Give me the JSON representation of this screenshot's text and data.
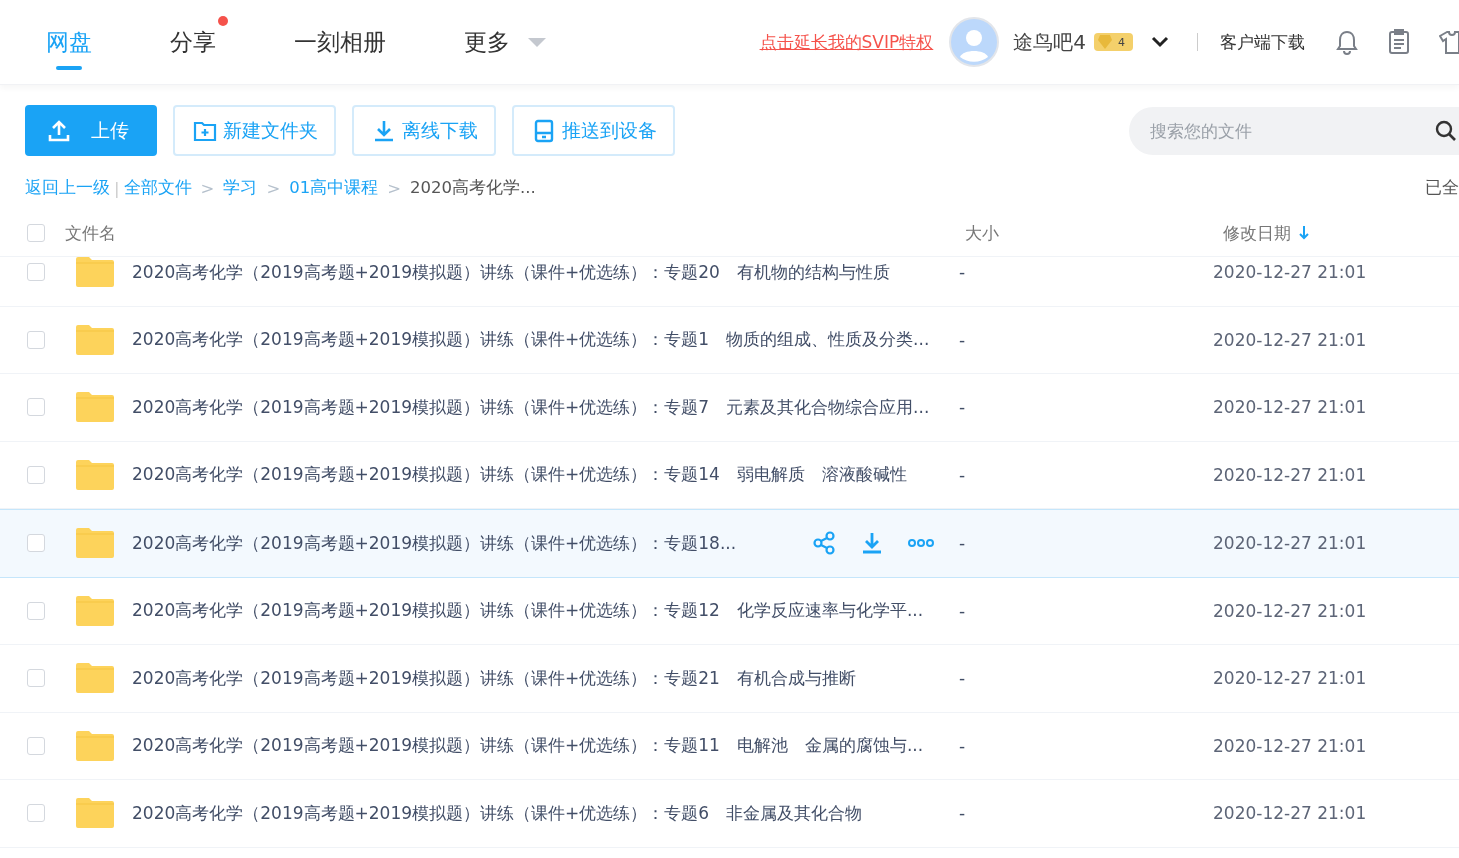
{
  "nav": {
    "tabs": [
      {
        "label": "网盘",
        "selected": true
      },
      {
        "label": "分享",
        "selected": false,
        "badge": true
      },
      {
        "label": "一刻相册",
        "selected": false
      },
      {
        "label": "更多",
        "selected": false,
        "dropdown": true
      }
    ],
    "promo_link": "点击延长我的SVIP特权",
    "username": "途鸟吧4",
    "vip_level": "4",
    "client_download": "客户端下载"
  },
  "toolbar": {
    "buttons": [
      {
        "label": "上传",
        "kind": "upload"
      },
      {
        "label": "新建文件夹",
        "kind": "folder"
      },
      {
        "label": "离线下载",
        "kind": "download"
      },
      {
        "label": "推送到设备",
        "kind": "device"
      }
    ],
    "search": {
      "placeholder": "搜索您的文件"
    }
  },
  "breadcrumb": {
    "back": "返回上一级",
    "divider": "|",
    "separator": ">",
    "path": [
      "全部文件",
      "学习",
      "01高中课程"
    ],
    "current": "2020高考化学...",
    "status": "已全"
  },
  "table": {
    "all_checked": false,
    "columns": [
      "文件名",
      "大小",
      "修改日期"
    ],
    "rows": [
      {
        "name": "2020高考化学（2019高考题+2019模拟题）讲练（课件+优选练）：专题20　有机物的结构与性质",
        "size": "-",
        "date": "2020-12-27 21:01",
        "checked": false,
        "hovered": false
      },
      {
        "name": "2020高考化学（2019高考题+2019模拟题）讲练（课件+优选练）：专题1　物质的组成、性质及分类...",
        "size": "-",
        "date": "2020-12-27 21:01",
        "checked": false,
        "hovered": false
      },
      {
        "name": "2020高考化学（2019高考题+2019模拟题）讲练（课件+优选练）：专题7　元素及其化合物综合应用...",
        "size": "-",
        "date": "2020-12-27 21:01",
        "checked": false,
        "hovered": false
      },
      {
        "name": "2020高考化学（2019高考题+2019模拟题）讲练（课件+优选练）：专题14　弱电解质　溶液酸碱性",
        "size": "-",
        "date": "2020-12-27 21:01",
        "checked": false,
        "hovered": false
      },
      {
        "name": "2020高考化学（2019高考题+2019模拟题）讲练（课件+优选练）：专题18...",
        "size": "-",
        "date": "2020-12-27 21:01",
        "checked": false,
        "hovered": true
      },
      {
        "name": "2020高考化学（2019高考题+2019模拟题）讲练（课件+优选练）：专题12　化学反应速率与化学平...",
        "size": "-",
        "date": "2020-12-27 21:01",
        "checked": false,
        "hovered": false
      },
      {
        "name": "2020高考化学（2019高考题+2019模拟题）讲练（课件+优选练）：专题21　有机合成与推断",
        "size": "-",
        "date": "2020-12-27 21:01",
        "checked": false,
        "hovered": false
      },
      {
        "name": "2020高考化学（2019高考题+2019模拟题）讲练（课件+优选练）：专题11　电解池　金属的腐蚀与...",
        "size": "-",
        "date": "2020-12-27 21:01",
        "checked": false,
        "hovered": false
      },
      {
        "name": "2020高考化学（2019高考题+2019模拟题）讲练（课件+优选练）：专题6　非金属及其化合物",
        "size": "-",
        "date": "2020-12-27 21:01",
        "checked": false,
        "hovered": false
      }
    ]
  }
}
